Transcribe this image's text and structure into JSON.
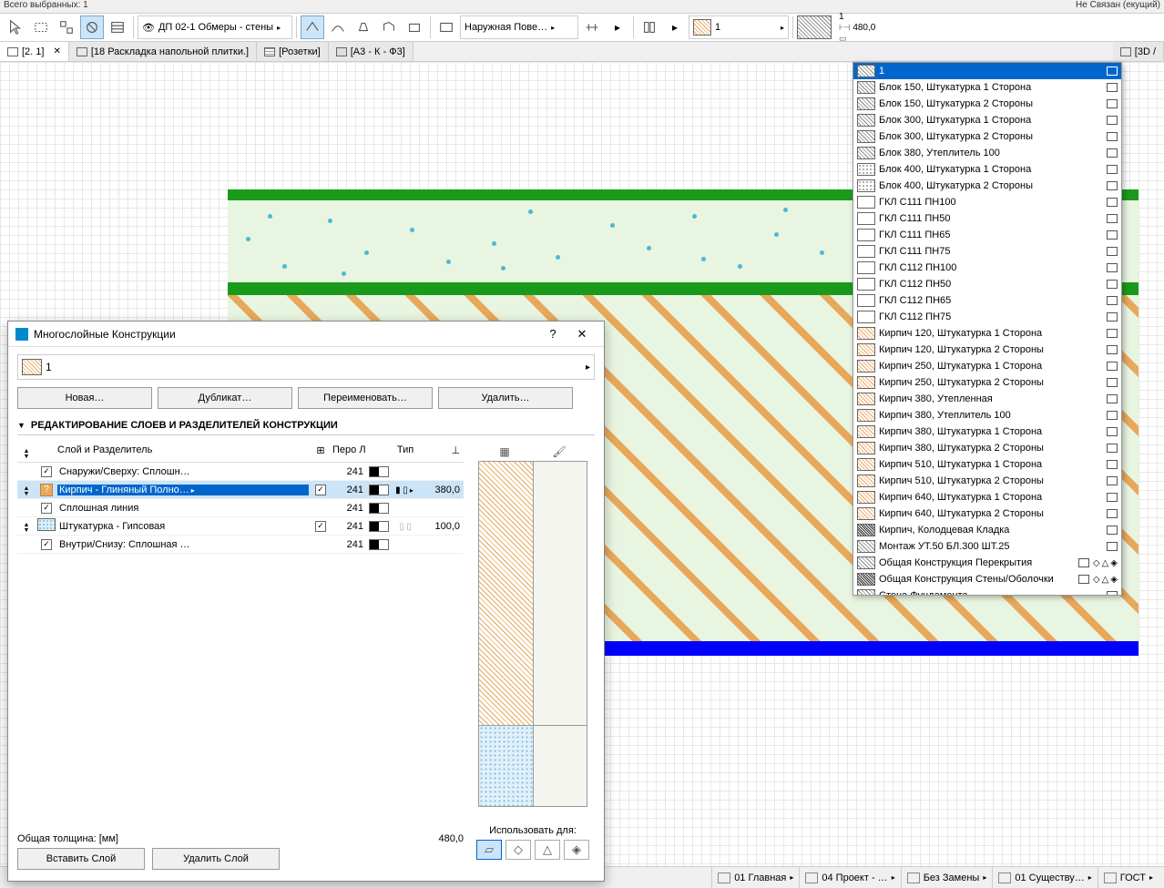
{
  "info_bar": {
    "left": "Всего выбранных: 1",
    "right_anchor": "Не Связан",
    "right_current": "(екущий)"
  },
  "toolbar": {
    "layer_dropdown": "ДП 02-1 Обмеры - стены",
    "surface_dropdown": "Наружная Пове…",
    "composite_name": "1",
    "wall_thickness": "480,0",
    "composite_input": "1"
  },
  "tabs": [
    {
      "label": "[2. 1]",
      "active": true,
      "closable": true
    },
    {
      "label": "[18 Раскладка напольной плитки.]"
    },
    {
      "label": "[Розетки]"
    },
    {
      "label": "[A3 - К - Ф3]"
    },
    {
      "label": "[3D /"
    }
  ],
  "dropdown": {
    "items": [
      {
        "label": "1",
        "sw": "sw-hatch",
        "selected": true
      },
      {
        "label": "Блок 150, Штукатурка 1 Сторона",
        "sw": "sw-hatch"
      },
      {
        "label": "Блок 150, Штукатурка 2 Стороны",
        "sw": "sw-hatch"
      },
      {
        "label": "Блок 300, Штукатурка 1 Сторона",
        "sw": "sw-hatch"
      },
      {
        "label": "Блок 300, Штукатурка 2 Стороны",
        "sw": "sw-hatch"
      },
      {
        "label": "Блок 380, Утеплитель 100",
        "sw": "sw-hatch"
      },
      {
        "label": "Блок 400, Штукатурка 1 Сторона",
        "sw": "sw-dots"
      },
      {
        "label": "Блок 400, Штукатурка 2 Стороны",
        "sw": "sw-dots"
      },
      {
        "label": "ГКЛ С111 ПН100",
        "sw": "sw-white"
      },
      {
        "label": "ГКЛ С111 ПН50",
        "sw": "sw-white"
      },
      {
        "label": "ГКЛ С111 ПН65",
        "sw": "sw-white"
      },
      {
        "label": "ГКЛ С111 ПН75",
        "sw": "sw-white"
      },
      {
        "label": "ГКЛ С112 ПН100",
        "sw": "sw-white"
      },
      {
        "label": "ГКЛ С112 ПН50",
        "sw": "sw-white"
      },
      {
        "label": "ГКЛ С112 ПН65",
        "sw": "sw-white"
      },
      {
        "label": "ГКЛ С112 ПН75",
        "sw": "sw-white"
      },
      {
        "label": "Кирпич 120, Штукатурка 1 Сторона",
        "sw": "sw-hatch-o"
      },
      {
        "label": "Кирпич 120, Штукатурка 2 Стороны",
        "sw": "sw-hatch-o"
      },
      {
        "label": "Кирпич 250, Штукатурка 1 Сторона",
        "sw": "sw-hatch-o"
      },
      {
        "label": "Кирпич 250, Штукатурка 2 Стороны",
        "sw": "sw-hatch-o"
      },
      {
        "label": "Кирпич 380, Утепленная",
        "sw": "sw-hatch-o"
      },
      {
        "label": "Кирпич 380, Утеплитель 100",
        "sw": "sw-hatch-o"
      },
      {
        "label": "Кирпич 380, Штукатурка 1 Сторона",
        "sw": "sw-hatch-o"
      },
      {
        "label": "Кирпич 380, Штукатурка 2 Стороны",
        "sw": "sw-hatch-o"
      },
      {
        "label": "Кирпич 510, Штукатурка 1 Сторона",
        "sw": "sw-hatch-o"
      },
      {
        "label": "Кирпич 510, Штукатурка 2 Стороны",
        "sw": "sw-hatch-o"
      },
      {
        "label": "Кирпич 640, Штукатурка 1 Сторона",
        "sw": "sw-hatch-o"
      },
      {
        "label": "Кирпич 640, Штукатурка 2 Стороны",
        "sw": "sw-hatch-o"
      },
      {
        "label": "Кирпич, Колодцевая Кладка",
        "sw": "sw-dark"
      },
      {
        "label": "Монтаж УТ.50 БЛ.300 ШТ.25",
        "sw": "sw-hatch"
      },
      {
        "label": "Общая Конструкция Перекрытия",
        "sw": "sw-hatch",
        "extra": true
      },
      {
        "label": "Общая Конструкция Стены/Оболочки",
        "sw": "sw-dark",
        "extra": true
      },
      {
        "label": "Стена Фундамента",
        "sw": "sw-cross"
      }
    ]
  },
  "dialog": {
    "title": "Многослойные Конструкции",
    "name": "1",
    "buttons": {
      "new": "Новая…",
      "duplicate": "Дубликат…",
      "rename": "Переименовать…",
      "delete": "Удалить…"
    },
    "section_header": "РЕДАКТИРОВАНИЕ СЛОЕВ И РАЗДЕЛИТЕЛЕЙ КОНСТРУКЦИИ",
    "columns": {
      "layer": "Слой и Разделитель",
      "pen": "Перо Линии",
      "type": "Тип"
    },
    "rows": [
      {
        "chk": true,
        "sw": "",
        "name": "Снаружи/Сверху: Сплошн…",
        "pen": "241",
        "thickness": ""
      },
      {
        "selected": true,
        "q": true,
        "sw": "sw-hatch-o",
        "name": "Кирпич - Глиняный Полно…",
        "chk2": true,
        "pen": "241",
        "type_icons": true,
        "thickness": "380,0"
      },
      {
        "chk": true,
        "sw": "",
        "name": "Сплошная линия",
        "pen": "241",
        "thickness": ""
      },
      {
        "sw": "sw-dots-blue",
        "name": "Штукатурка - Гипсовая",
        "chk2": true,
        "pen": "241",
        "type_light": true,
        "thickness": "100,0"
      },
      {
        "chk": true,
        "sw": "",
        "name": "Внутри/Снизу: Сплошная …",
        "pen": "241",
        "thickness": ""
      }
    ],
    "total_label": "Общая толщина: [мм]",
    "total_value": "480,0",
    "use_for": "Использовать для:",
    "insert_layer": "Вставить Слой",
    "delete_layer": "Удалить Слой"
  },
  "status": {
    "items": [
      {
        "label": "01 Главная"
      },
      {
        "label": "04 Проект - …"
      },
      {
        "label": "Без Замены"
      },
      {
        "label": "01 Существу…"
      },
      {
        "label": "ГОСТ"
      }
    ]
  }
}
